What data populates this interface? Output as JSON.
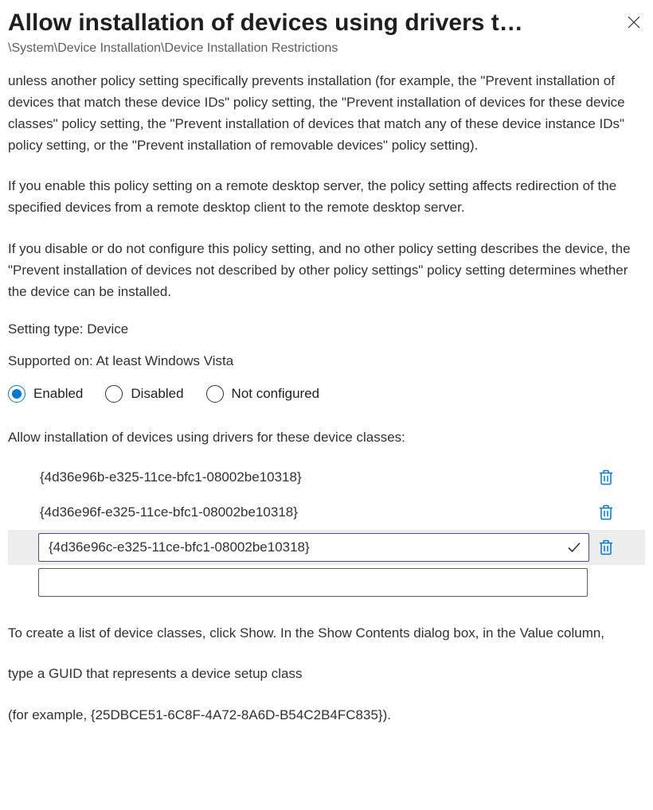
{
  "header": {
    "title": "Allow installation of devices using drivers t…",
    "breadcrumb": "\\System\\Device Installation\\Device Installation Restrictions"
  },
  "description": {
    "p1": "unless another policy setting specifically prevents installation (for example, the \"Prevent installation of devices that match these device IDs\" policy setting, the \"Prevent installation of devices for these device classes\" policy setting, the \"Prevent installation of devices that match any of these device instance IDs\" policy setting, or the \"Prevent installation of removable devices\" policy setting).",
    "p2": "If you enable this policy setting on a remote desktop server, the policy setting affects redirection of the specified devices from a remote desktop client to the remote desktop server.",
    "p3": "If you disable or do not configure this policy setting, and no other policy setting describes the device, the \"Prevent installation of devices not described by other policy settings\" policy setting determines whether the device can be installed."
  },
  "meta": {
    "setting_type": "Setting type: Device",
    "supported_on": "Supported on: At least Windows Vista"
  },
  "state": {
    "options": {
      "enabled": "Enabled",
      "disabled": "Disabled",
      "not_configured": "Not configured"
    },
    "selected": "enabled"
  },
  "list": {
    "label": "Allow installation of devices using drivers for these device classes:",
    "items": [
      {
        "value": "{4d36e96b-e325-11ce-bfc1-08002be10318}"
      },
      {
        "value": "{4d36e96f-e325-11ce-bfc1-08002be10318}"
      }
    ],
    "editing_value": "{4d36e96c-e325-11ce-bfc1-08002be10318}",
    "blank_value": ""
  },
  "help": {
    "p1": "To create a list of device classes, click Show. In the Show Contents dialog box, in the Value column,",
    "p2": "type a GUID that represents a device setup class",
    "p3": "(for example, {25DBCE51-6C8F-4A72-8A6D-B54C2B4FC835})."
  }
}
